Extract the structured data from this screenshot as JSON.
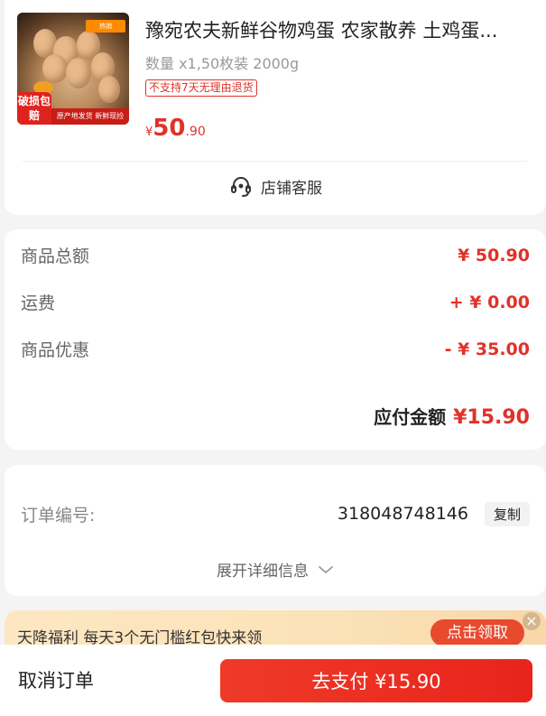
{
  "product": {
    "image_badge_hot": "热销",
    "image_broken_label": "破损包赔",
    "image_banner": "原产地发货 新鲜现捡",
    "title": "豫宛农夫新鲜谷物鸡蛋 农家散养 土鸡蛋...",
    "spec": "数量 x1,50枚装 2000g",
    "return_policy": "不支持7天无理由退货",
    "price_currency": "¥",
    "price_int": "50",
    "price_dec": ".90"
  },
  "service": {
    "label": "店铺客服",
    "icon": "headset-icon"
  },
  "summary": {
    "goods_total_label": "商品总额",
    "goods_total_value": "¥ 50.90",
    "shipping_label": "运费",
    "shipping_value": "+ ¥ 0.00",
    "discount_label": "商品优惠",
    "discount_value": "- ¥ 35.00",
    "payable_label": "应付金额",
    "payable_value": "¥15.90"
  },
  "order": {
    "number_label": "订单编号:",
    "number_value": "318048748146",
    "copy_label": "复制",
    "expand_label": "展开详细信息"
  },
  "promo": {
    "text": "天降福利 每天3个无门槛红包快来领",
    "claim_label": "点击领取",
    "close_icon": "×"
  },
  "actions": {
    "cancel_label": "取消订单",
    "pay_label": "去支付 ¥15.90"
  },
  "colors": {
    "accent": "#e0322a",
    "pay_button": "#e8241c",
    "promo_bg": "#fbe2b8"
  }
}
